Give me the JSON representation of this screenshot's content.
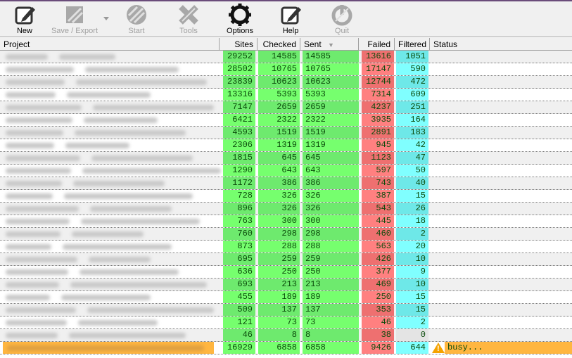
{
  "toolbar": {
    "items": [
      {
        "label": "New",
        "icon": "new-edit-icon",
        "enabled": true
      },
      {
        "label": "Save / Export",
        "icon": "save-export-icon",
        "enabled": false
      },
      {
        "label": "Start",
        "icon": "start-icon",
        "enabled": false
      },
      {
        "label": "Tools",
        "icon": "tools-icon",
        "enabled": false
      },
      {
        "label": "Options",
        "icon": "gear-icon",
        "enabled": true
      },
      {
        "label": "Help",
        "icon": "help-edit-icon",
        "enabled": true
      },
      {
        "label": "Quit",
        "icon": "quit-icon",
        "enabled": false
      }
    ]
  },
  "table": {
    "columns": [
      "Project",
      "Sites",
      "Checked",
      "Sent",
      "Failed",
      "Filtered",
      "Status"
    ],
    "sort_column": "Sent",
    "colors": {
      "green": "#76ff6e",
      "green_alt": "#6eea6e",
      "red": "#ff8080",
      "red_alt": "#ee7070",
      "cyan": "#80ffff",
      "cyan_alt": "#6ee8e8",
      "busy": "#ffb640",
      "text": "#0a4a0a"
    },
    "rows": [
      {
        "sites": "29252",
        "checked": "14585",
        "sent": "14585",
        "failed": "13616",
        "filtered": "1051",
        "status": ""
      },
      {
        "sites": "28502",
        "checked": "10765",
        "sent": "10765",
        "failed": "17147",
        "filtered": "590",
        "status": ""
      },
      {
        "sites": "23839",
        "checked": "10623",
        "sent": "10623",
        "failed": "12744",
        "filtered": "472",
        "status": ""
      },
      {
        "sites": "13316",
        "checked": "5393",
        "sent": "5393",
        "failed": "7314",
        "filtered": "609",
        "status": ""
      },
      {
        "sites": "7147",
        "checked": "2659",
        "sent": "2659",
        "failed": "4237",
        "filtered": "251",
        "status": ""
      },
      {
        "sites": "6421",
        "checked": "2322",
        "sent": "2322",
        "failed": "3935",
        "filtered": "164",
        "status": ""
      },
      {
        "sites": "4593",
        "checked": "1519",
        "sent": "1519",
        "failed": "2891",
        "filtered": "183",
        "status": ""
      },
      {
        "sites": "2306",
        "checked": "1319",
        "sent": "1319",
        "failed": "945",
        "filtered": "42",
        "status": ""
      },
      {
        "sites": "1815",
        "checked": "645",
        "sent": "645",
        "failed": "1123",
        "filtered": "47",
        "status": ""
      },
      {
        "sites": "1290",
        "checked": "643",
        "sent": "643",
        "failed": "597",
        "filtered": "50",
        "status": ""
      },
      {
        "sites": "1172",
        "checked": "386",
        "sent": "386",
        "failed": "743",
        "filtered": "40",
        "status": ""
      },
      {
        "sites": "728",
        "checked": "326",
        "sent": "326",
        "failed": "387",
        "filtered": "15",
        "status": ""
      },
      {
        "sites": "896",
        "checked": "326",
        "sent": "326",
        "failed": "543",
        "filtered": "26",
        "status": ""
      },
      {
        "sites": "763",
        "checked": "300",
        "sent": "300",
        "failed": "445",
        "filtered": "18",
        "status": ""
      },
      {
        "sites": "760",
        "checked": "298",
        "sent": "298",
        "failed": "460",
        "filtered": "2",
        "status": ""
      },
      {
        "sites": "873",
        "checked": "288",
        "sent": "288",
        "failed": "563",
        "filtered": "20",
        "status": ""
      },
      {
        "sites": "695",
        "checked": "259",
        "sent": "259",
        "failed": "426",
        "filtered": "10",
        "status": ""
      },
      {
        "sites": "636",
        "checked": "250",
        "sent": "250",
        "failed": "377",
        "filtered": "9",
        "status": ""
      },
      {
        "sites": "693",
        "checked": "213",
        "sent": "213",
        "failed": "469",
        "filtered": "10",
        "status": ""
      },
      {
        "sites": "455",
        "checked": "189",
        "sent": "189",
        "failed": "250",
        "filtered": "15",
        "status": ""
      },
      {
        "sites": "509",
        "checked": "137",
        "sent": "137",
        "failed": "353",
        "filtered": "15",
        "status": ""
      },
      {
        "sites": "121",
        "checked": "73",
        "sent": "73",
        "failed": "46",
        "filtered": "2",
        "status": ""
      },
      {
        "sites": "46",
        "checked": "8",
        "sent": "8",
        "failed": "38",
        "filtered": "0",
        "status": ""
      },
      {
        "sites": "16929",
        "checked": "6858",
        "sent": "6858",
        "failed": "9426",
        "filtered": "644",
        "status": "busy...",
        "warning": true
      }
    ]
  }
}
